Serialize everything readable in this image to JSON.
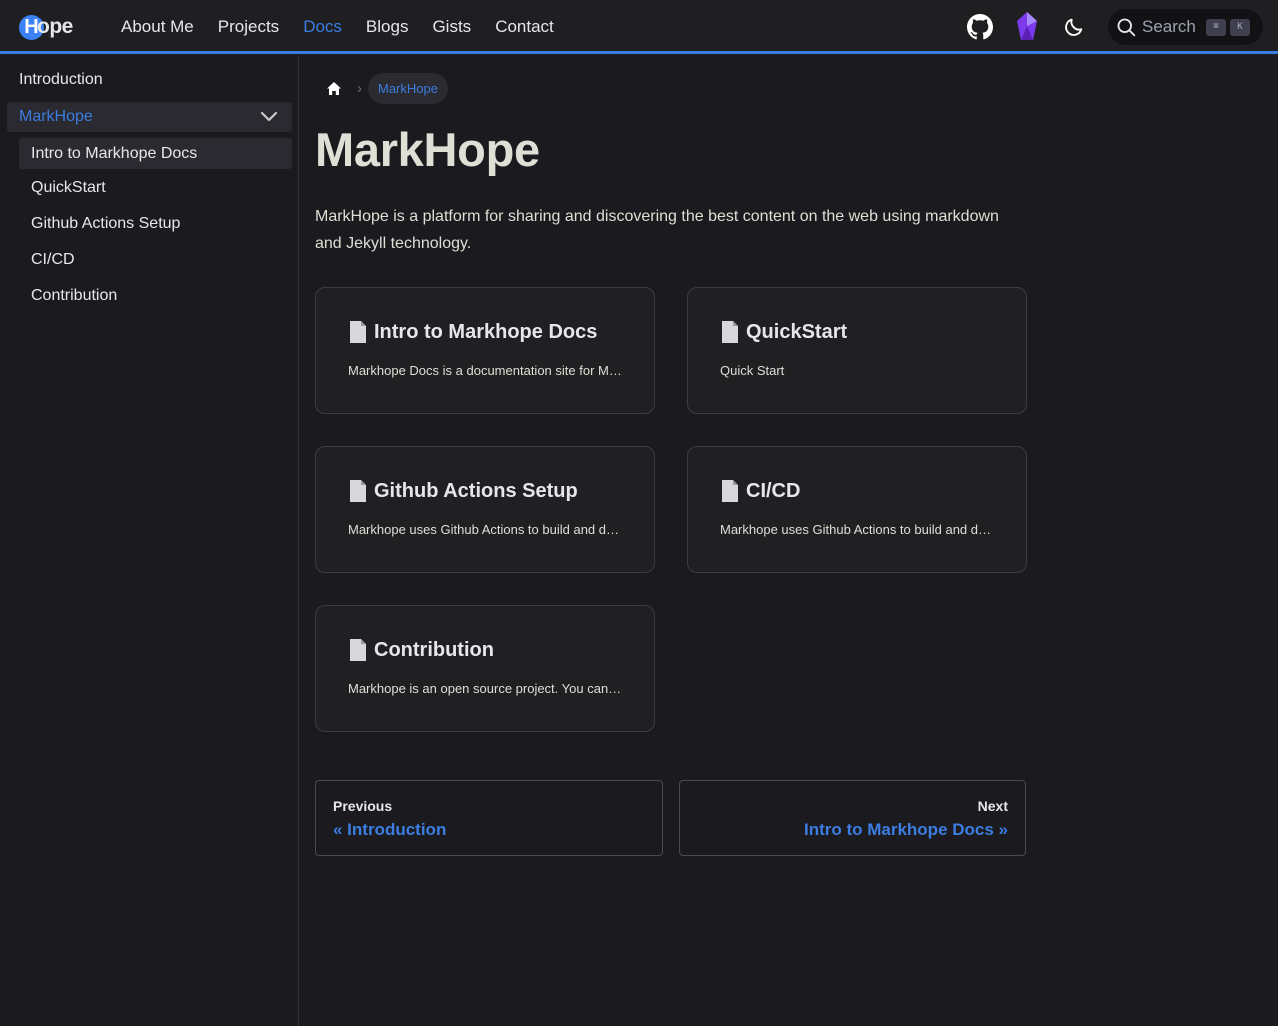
{
  "header": {
    "logo_letter": "H",
    "logo_text": "ope",
    "nav": [
      "About Me",
      "Projects",
      "Docs",
      "Blogs",
      "Gists",
      "Contact"
    ],
    "active_nav": "Docs",
    "search_placeholder": "Search",
    "search_keys": [
      "⌘",
      "K"
    ]
  },
  "sidebar": {
    "top_item": "Introduction",
    "group_label": "MarkHope",
    "sub_items": [
      "Intro to Markhope Docs",
      "QuickStart",
      "Github Actions Setup",
      "CI/CD",
      "Contribution"
    ],
    "active_sub": "Intro to Markhope Docs"
  },
  "main": {
    "breadcrumb_current": "MarkHope",
    "title": "MarkHope",
    "intro": "MarkHope is a platform for sharing and discovering the best content on the web using markdown and Jekyll technology.",
    "cards": [
      {
        "title": "Intro to Markhope Docs",
        "desc": "Markhope Docs is a documentation site for Markhope."
      },
      {
        "title": "QuickStart",
        "desc": "Quick Start"
      },
      {
        "title": "Github Actions Setup",
        "desc": "Markhope uses Github Actions to build and deploy."
      },
      {
        "title": "CI/CD",
        "desc": "Markhope uses Github Actions to build and deploy."
      },
      {
        "title": "Contribution",
        "desc": "Markhope is an open source project. You can contribute."
      }
    ],
    "prev": {
      "label": "Previous",
      "link": "« Introduction"
    },
    "next": {
      "label": "Next",
      "link": "Intro to Markhope Docs »"
    }
  },
  "colors": {
    "accent": "#3b7de0",
    "background": "#1b1b1f"
  }
}
